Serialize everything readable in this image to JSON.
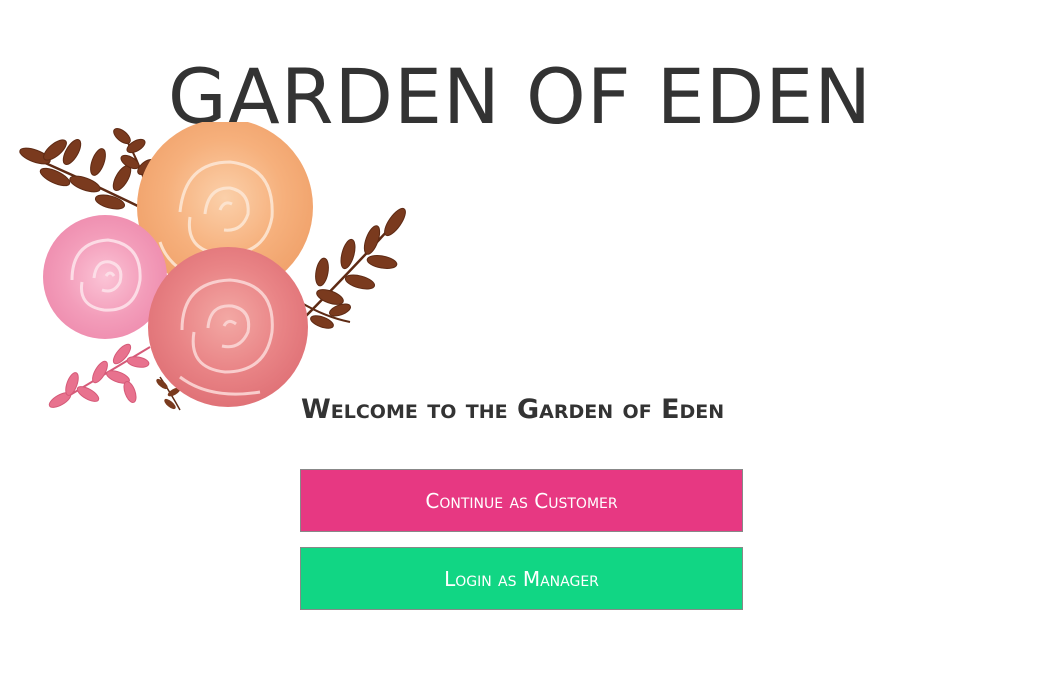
{
  "app": {
    "title": "GARDEN OF EDEN",
    "welcome": "Welcome to the Garden of Eden"
  },
  "actions": {
    "customer_label": "Continue as Customer",
    "manager_label": "Login as Manager"
  },
  "colors": {
    "customer_button": "#e73882",
    "manager_button": "#11d684",
    "title_text": "#333333"
  },
  "illustration": {
    "icon": "watercolor-roses-icon"
  }
}
